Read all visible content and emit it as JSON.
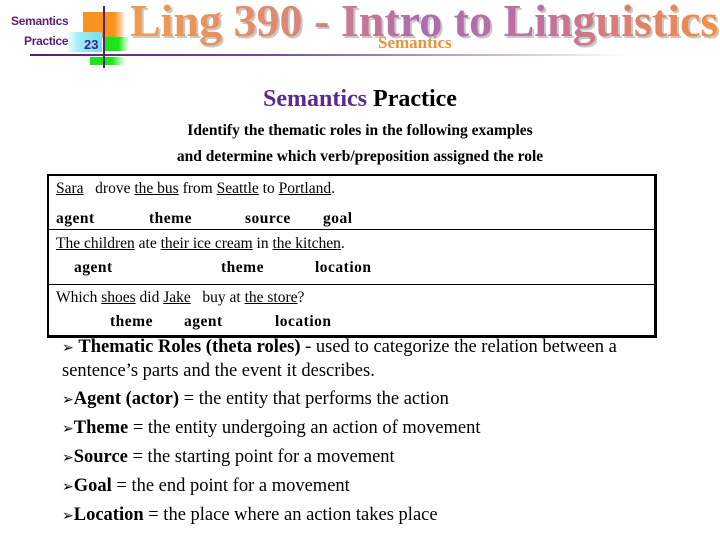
{
  "header": {
    "corner_label_1": "Semantics",
    "corner_label_2": "Practice",
    "slide_number": "23",
    "course_title": "Ling 390 - Intro to Linguistics",
    "course_subtitle": "Semantics"
  },
  "slide": {
    "title_part1": "Semantics",
    "title_part2": " Practice",
    "instruction_line1": "Identify the thematic roles in the following examples",
    "instruction_line2": "and determine which verb/preposition assigned the role"
  },
  "examples": [
    {
      "sentence": [
        {
          "text": "Sara",
          "u": true
        },
        {
          "text": "   drove ",
          "u": false
        },
        {
          "text": "the bus",
          "u": true
        },
        {
          "text": " from ",
          "u": false
        },
        {
          "text": "Seattle",
          "u": true
        },
        {
          "text": " to ",
          "u": false
        },
        {
          "text": "Portland",
          "u": true
        },
        {
          "text": ".",
          "u": false
        }
      ],
      "roles": [
        "agent",
        "theme",
        "source",
        "goal"
      ]
    },
    {
      "sentence": [
        {
          "text": "The children",
          "u": true
        },
        {
          "text": " ate ",
          "u": false
        },
        {
          "text": "their ice cream",
          "u": true
        },
        {
          "text": " in ",
          "u": false
        },
        {
          "text": "the kitchen",
          "u": true
        },
        {
          "text": ".",
          "u": false
        }
      ],
      "roles": [
        "agent",
        "theme",
        "location"
      ]
    },
    {
      "sentence": [
        {
          "text": "Which ",
          "u": false
        },
        {
          "text": "shoes",
          "u": true
        },
        {
          "text": " did ",
          "u": false
        },
        {
          "text": "Jake",
          "u": true
        },
        {
          "text": "   buy at ",
          "u": false
        },
        {
          "text": "the store",
          "u": true
        },
        {
          "text": "?",
          "u": false
        }
      ],
      "roles": [
        "theme",
        "agent",
        "location"
      ]
    }
  ],
  "definitions": {
    "intro_bold": "Thematic Roles (theta roles)",
    "intro_rest_line1": " - used to categorize the relation between a",
    "intro_line2": "sentence’s parts and the event it describes.",
    "items": [
      {
        "term": "Agent (actor)",
        "desc": " = the entity that performs the action"
      },
      {
        "term": "Theme",
        "desc": " = the entity undergoing an action of movement"
      },
      {
        "term": "Source",
        "desc": " = the starting point for a movement"
      },
      {
        "term": "Goal",
        "desc": " = the end point for a movement"
      },
      {
        "term": "Location",
        "desc": " = the place where an action takes place"
      }
    ],
    "bullet_icon": "arrow-bullet-icon",
    "bullet_glyph": "➢"
  },
  "colors": {
    "accent_purple": "#5b2a90",
    "accent_orange": "#f7931e",
    "accent_green": "#19e619",
    "accent_cyan": "#70e0f0"
  }
}
